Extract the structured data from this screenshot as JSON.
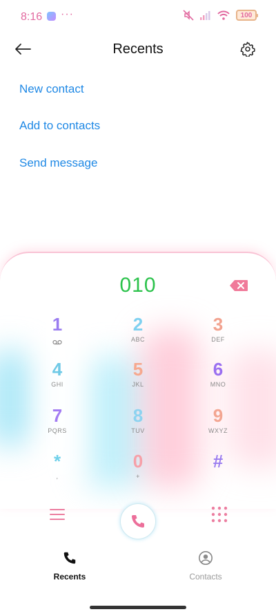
{
  "status_bar": {
    "time": "8:16",
    "dots": "···",
    "battery": "100",
    "icons": [
      "app-notification-icon",
      "mute-icon",
      "signal-icon",
      "wifi-icon",
      "battery-icon"
    ]
  },
  "header": {
    "title": "Recents",
    "icons": [
      "back-arrow-icon",
      "settings-gear-icon"
    ]
  },
  "actions": {
    "new_contact": "New contact",
    "add_to_contacts": "Add to contacts",
    "send_message": "Send message"
  },
  "dialer": {
    "number": "010",
    "keys": [
      {
        "digit": "1",
        "letters": "",
        "color": "#9a7cf0"
      },
      {
        "digit": "2",
        "letters": "ABC",
        "color": "#7fd0f0"
      },
      {
        "digit": "3",
        "letters": "DEF",
        "color": "#f2a28f"
      },
      {
        "digit": "4",
        "letters": "GHI",
        "color": "#6fc9e6"
      },
      {
        "digit": "5",
        "letters": "JKL",
        "color": "#f6a88e"
      },
      {
        "digit": "6",
        "letters": "MNO",
        "color": "#9a6ff0"
      },
      {
        "digit": "7",
        "letters": "PQRS",
        "color": "#a27bf2"
      },
      {
        "digit": "8",
        "letters": "TUV",
        "color": "#8cd3f0"
      },
      {
        "digit": "9",
        "letters": "WXYZ",
        "color": "#f3a591"
      },
      {
        "digit": "*",
        "letters": ",",
        "color": "#6fd0ea"
      },
      {
        "digit": "0",
        "letters": "+",
        "color": "#f6a0a8"
      },
      {
        "digit": "#",
        "letters": "",
        "color": "#9a7cf0"
      }
    ]
  },
  "colors": {
    "accent_pink": "#e8709a",
    "number_green": "#2bc24b",
    "link_blue": "#1e88e5"
  },
  "bottom_nav": {
    "recents": "Recents",
    "contacts": "Contacts"
  }
}
